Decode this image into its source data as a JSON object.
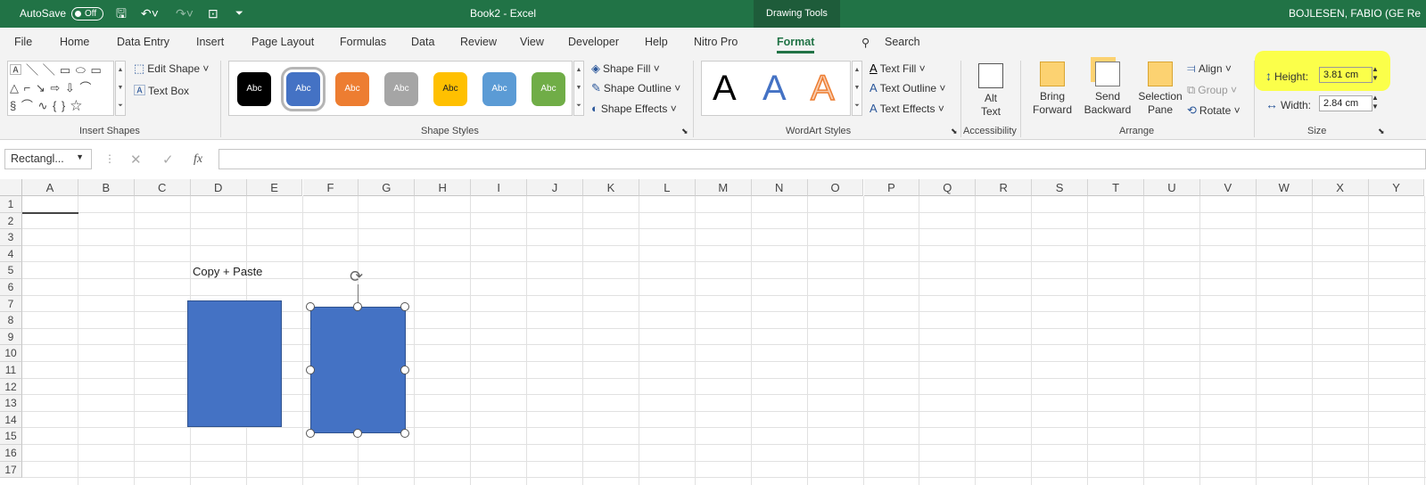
{
  "titlebar": {
    "autosave_label": "AutoSave",
    "autosave_state": "Off",
    "document_title": "Book2  -  Excel",
    "context_tab": "Drawing Tools",
    "user": "BOJLESEN, FABIO (GE Re"
  },
  "menu": [
    "File",
    "Home",
    "Data Entry",
    "Insert",
    "Page Layout",
    "Formulas",
    "Data",
    "Review",
    "View",
    "Developer",
    "Help",
    "Nitro Pro",
    "Format"
  ],
  "active_menu": "Format",
  "search_label": "Search",
  "ribbon": {
    "insert_shapes": {
      "label": "Insert Shapes",
      "shape_glyphs": [
        "🄰 ╲ ╲ ▭ ⬭ ▭",
        "△ ⌐ ↘ ⇨ ⇩ ⌒",
        "§ ⌒ ∿ { } ☆"
      ],
      "edit_shape": "Edit Shape",
      "text_box": "Text Box"
    },
    "shape_styles": {
      "label": "Shape Styles",
      "swatch_text": "Abc",
      "swatches": [
        "#000000",
        "#4472c4",
        "#ed7d31",
        "#a5a5a5",
        "#ffc000",
        "#5b9bd5",
        "#70ad47"
      ],
      "shape_fill": "Shape Fill",
      "shape_outline": "Shape Outline",
      "shape_effects": "Shape Effects"
    },
    "wordart": {
      "label": "WordArt Styles",
      "letter": "A",
      "text_fill": "Text Fill",
      "text_outline": "Text Outline",
      "text_effects": "Text Effects"
    },
    "accessibility": {
      "label": "Accessibility",
      "alt_text_1": "Alt",
      "alt_text_2": "Text"
    },
    "arrange": {
      "label": "Arrange",
      "bring_forward": [
        "Bring",
        "Forward"
      ],
      "send_backward": [
        "Send",
        "Backward"
      ],
      "selection_pane": [
        "Selection",
        "Pane"
      ],
      "align": "Align",
      "group": "Group",
      "rotate": "Rotate"
    },
    "size": {
      "label": "Size",
      "height_label": "Height:",
      "height_value": "3.81 cm",
      "width_label": "Width:",
      "width_value": "2.84 cm"
    }
  },
  "formula_bar": {
    "name_box": "Rectangl...",
    "fx": "fx"
  },
  "grid": {
    "columns": [
      "A",
      "B",
      "C",
      "D",
      "E",
      "F",
      "G",
      "H",
      "I",
      "J",
      "K",
      "L",
      "M",
      "N",
      "O",
      "P",
      "Q",
      "R",
      "S",
      "T",
      "U",
      "V",
      "W",
      "X",
      "Y"
    ],
    "rows": [
      "1",
      "2",
      "3",
      "4",
      "5",
      "6",
      "7",
      "8",
      "9",
      "10",
      "11",
      "12",
      "13",
      "14",
      "15",
      "16",
      "17"
    ],
    "cell_text": "Copy + Paste",
    "shape_color": "#4472c4"
  }
}
